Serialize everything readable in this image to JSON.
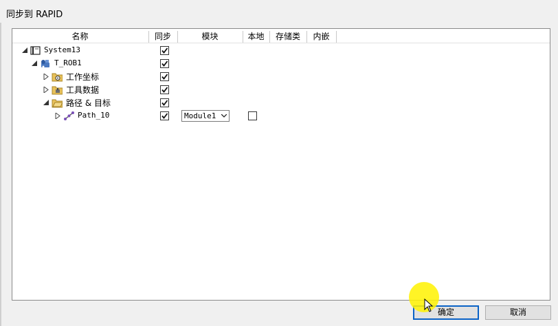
{
  "dialog": {
    "title": "同步到 RAPID"
  },
  "columns": [
    "名称",
    "同步",
    "模块",
    "本地",
    "存储类",
    "内嵌"
  ],
  "tree": [
    {
      "label": "System13",
      "icon": "system-book-icon",
      "expanded": true,
      "synced": true
    },
    {
      "label": "T_ROB1",
      "icon": "robot-task-icon",
      "expanded": true,
      "synced": true
    },
    {
      "label": "工作坐标",
      "icon": "workobject-folder-icon",
      "expanded": false,
      "synced": true
    },
    {
      "label": "工具数据",
      "icon": "tooldata-folder-icon",
      "expanded": false,
      "synced": true
    },
    {
      "label": "路径 & 目标",
      "icon": "paths-targets-folder-icon",
      "expanded": true,
      "synced": true
    },
    {
      "label": "Path_10",
      "icon": "path-icon",
      "expanded": false,
      "synced": true,
      "module": "Module1",
      "local": false
    }
  ],
  "buttons": {
    "ok": "确定",
    "cancel": "取消"
  },
  "colors": {
    "accent_border": "#0a62c6",
    "cursor_highlight": "#fff200"
  }
}
